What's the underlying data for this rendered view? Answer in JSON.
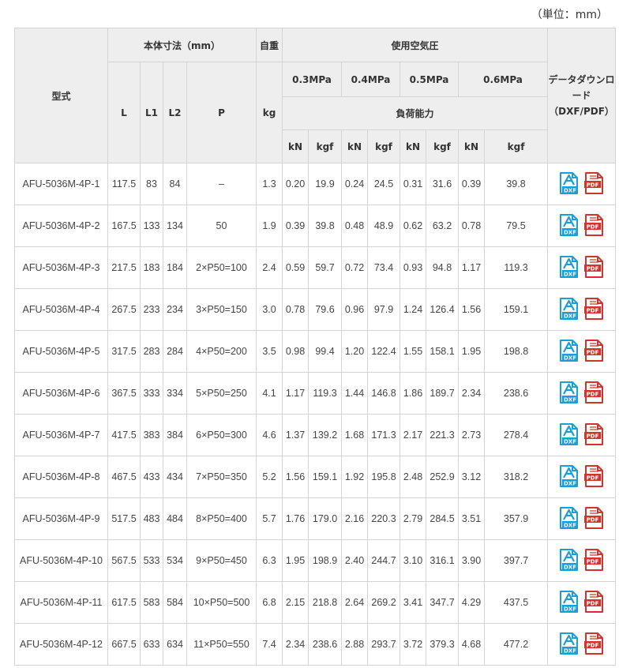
{
  "unit_note": "（単位：mm）",
  "header": {
    "model": "型式",
    "dimensions": "本体寸法（mm）",
    "weight": "自重",
    "air_pressure": "使用空気圧",
    "download": "データダウンロード（DXF/PDF）",
    "L": "L",
    "L1": "L1",
    "L2": "L2",
    "P": "P",
    "kg": "kg",
    "pressures": [
      "0.3MPa",
      "0.4MPa",
      "0.5MPa",
      "0.6MPa"
    ],
    "load_capacity": "負荷能力",
    "kN": "kN",
    "kgf": "kgf"
  },
  "icons": {
    "dxf": {
      "name": "dxf-file-icon",
      "label": "DXF",
      "color": "#1a9ed8"
    },
    "pdf": {
      "name": "pdf-file-icon",
      "label": "PDF",
      "color": "#d0342c"
    }
  },
  "rows": [
    {
      "model": "AFU-5036M-4P-1",
      "L": "117.5",
      "L1": "83",
      "L2": "84",
      "P": "–",
      "kg": "1.3",
      "v": [
        "0.20",
        "19.9",
        "0.24",
        "24.5",
        "0.31",
        "31.6",
        "0.39",
        "39.8"
      ]
    },
    {
      "model": "AFU-5036M-4P-2",
      "L": "167.5",
      "L1": "133",
      "L2": "134",
      "P": "50",
      "kg": "1.9",
      "v": [
        "0.39",
        "39.8",
        "0.48",
        "48.9",
        "0.62",
        "63.2",
        "0.78",
        "79.5"
      ]
    },
    {
      "model": "AFU-5036M-4P-3",
      "L": "217.5",
      "L1": "183",
      "L2": "184",
      "P": "2×P50=100",
      "kg": "2.4",
      "v": [
        "0.59",
        "59.7",
        "0.72",
        "73.4",
        "0.93",
        "94.8",
        "1.17",
        "119.3"
      ]
    },
    {
      "model": "AFU-5036M-4P-4",
      "L": "267.5",
      "L1": "233",
      "L2": "234",
      "P": "3×P50=150",
      "kg": "3.0",
      "v": [
        "0.78",
        "79.6",
        "0.96",
        "97.9",
        "1.24",
        "126.4",
        "1.56",
        "159.1"
      ]
    },
    {
      "model": "AFU-5036M-4P-5",
      "L": "317.5",
      "L1": "283",
      "L2": "284",
      "P": "4×P50=200",
      "kg": "3.5",
      "v": [
        "0.98",
        "99.4",
        "1.20",
        "122.4",
        "1.55",
        "158.1",
        "1.95",
        "198.8"
      ]
    },
    {
      "model": "AFU-5036M-4P-6",
      "L": "367.5",
      "L1": "333",
      "L2": "334",
      "P": "5×P50=250",
      "kg": "4.1",
      "v": [
        "1.17",
        "119.3",
        "1.44",
        "146.8",
        "1.86",
        "189.7",
        "2.34",
        "238.6"
      ]
    },
    {
      "model": "AFU-5036M-4P-7",
      "L": "417.5",
      "L1": "383",
      "L2": "384",
      "P": "6×P50=300",
      "kg": "4.6",
      "v": [
        "1.37",
        "139.2",
        "1.68",
        "171.3",
        "2.17",
        "221.3",
        "2.73",
        "278.4"
      ]
    },
    {
      "model": "AFU-5036M-4P-8",
      "L": "467.5",
      "L1": "433",
      "L2": "434",
      "P": "7×P50=350",
      "kg": "5.2",
      "v": [
        "1.56",
        "159.1",
        "1.92",
        "195.8",
        "2.48",
        "252.9",
        "3.12",
        "318.2"
      ]
    },
    {
      "model": "AFU-5036M-4P-9",
      "L": "517.5",
      "L1": "483",
      "L2": "484",
      "P": "8×P50=400",
      "kg": "5.7",
      "v": [
        "1.76",
        "179.0",
        "2.16",
        "220.3",
        "2.79",
        "284.5",
        "3.51",
        "357.9"
      ]
    },
    {
      "model": "AFU-5036M-4P-10",
      "L": "567.5",
      "L1": "533",
      "L2": "534",
      "P": "9×P50=450",
      "kg": "6.3",
      "v": [
        "1.95",
        "198.9",
        "2.40",
        "244.7",
        "3.10",
        "316.1",
        "3.90",
        "397.7"
      ]
    },
    {
      "model": "AFU-5036M-4P-11",
      "L": "617.5",
      "L1": "583",
      "L2": "584",
      "P": "10×P50=500",
      "kg": "6.8",
      "v": [
        "2.15",
        "218.8",
        "2.64",
        "269.2",
        "3.41",
        "347.7",
        "4.29",
        "437.5"
      ]
    },
    {
      "model": "AFU-5036M-4P-12",
      "L": "667.5",
      "L1": "633",
      "L2": "634",
      "P": "11×P50=550",
      "kg": "7.4",
      "v": [
        "2.34",
        "238.6",
        "2.88",
        "293.7",
        "3.72",
        "379.3",
        "4.68",
        "477.2"
      ]
    }
  ]
}
